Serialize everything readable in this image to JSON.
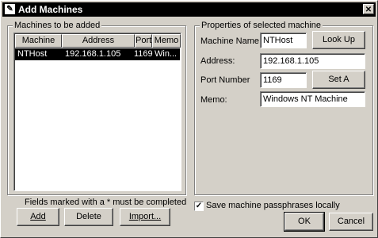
{
  "window": {
    "title": "Add Machines",
    "app_icon": "app-icon",
    "close_glyph": "✕"
  },
  "left_group": {
    "legend": "Machines to be added",
    "columns": [
      "Machine",
      "Address",
      "Port",
      "Memo"
    ],
    "rows": [
      {
        "machine": "NTHost",
        "address": "192.168.1.105",
        "port": "1169",
        "memo": "Win..."
      }
    ],
    "note": "Fields marked with a * must be completed",
    "buttons": {
      "add": "Add",
      "delete": "Delete",
      "import": "Import..."
    }
  },
  "right_group": {
    "legend": "Properties of selected machine",
    "machine_name_label": "Machine Name",
    "machine_name_value": "NTHost",
    "lookup_button": "Look Up",
    "address_label": "Address:",
    "address_value": "192.168.1.105",
    "port_label": "Port Number",
    "port_value": "1169",
    "set_button": "Set A",
    "memo_label": "Memo:",
    "memo_value": "Windows NT Machine"
  },
  "save_checkbox": {
    "label": "Save machine passphrases locally",
    "checked": true
  },
  "footer": {
    "ok": "OK",
    "cancel": "Cancel"
  }
}
